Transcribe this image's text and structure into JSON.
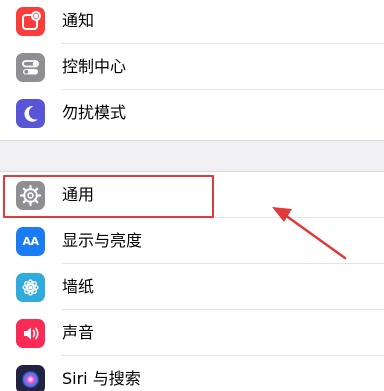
{
  "settings_group_1": [
    {
      "label": "通知",
      "icon": "notifications-icon",
      "color": "#fa3d3a"
    },
    {
      "label": "控制中心",
      "icon": "control-center-icon",
      "color": "#8e8e93"
    },
    {
      "label": "勿扰模式",
      "icon": "moon-icon",
      "color": "#5856d6"
    }
  ],
  "settings_group_2": [
    {
      "label": "通用",
      "icon": "gear-icon",
      "color": "#8e8e93"
    },
    {
      "label": "显示与亮度",
      "icon": "display-brightness-icon",
      "color": "#1a7cf5",
      "icon_text": "AA"
    },
    {
      "label": "墙纸",
      "icon": "wallpaper-icon",
      "color": "#33aadc"
    },
    {
      "label": "声音",
      "icon": "speaker-icon",
      "color": "#fa2c55"
    },
    {
      "label": "Siri 与搜索",
      "icon": "siri-icon",
      "color": "#222244"
    }
  ],
  "annotation": {
    "highlight_color": "#e03a3a"
  }
}
